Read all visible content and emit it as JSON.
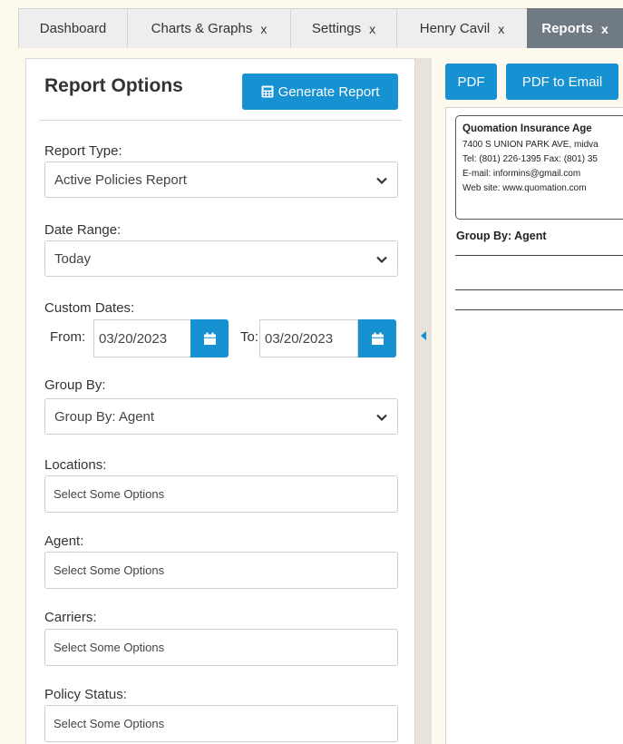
{
  "tabs": [
    {
      "label": "Dashboard",
      "closable": false
    },
    {
      "label": "Charts & Graphs",
      "closable": true
    },
    {
      "label": "Settings",
      "closable": true
    },
    {
      "label": "Henry Cavil",
      "closable": true
    },
    {
      "label": "Reports",
      "closable": true,
      "active": true
    }
  ],
  "tab_close_glyph": "x",
  "report_options": {
    "title": "Report Options",
    "generate_button": "Generate Report",
    "report_type": {
      "label": "Report Type:",
      "value": "Active Policies Report"
    },
    "date_range": {
      "label": "Date Range:",
      "value": "Today"
    },
    "custom_dates": {
      "label": "Custom Dates:",
      "from_label": "From:",
      "from_value": "03/20/2023",
      "to_label": "To:",
      "to_value": "03/20/2023"
    },
    "group_by": {
      "label": "Group By:",
      "value": "Group By: Agent"
    },
    "locations": {
      "label": "Locations:",
      "placeholder": "Select Some Options"
    },
    "agent": {
      "label": "Agent:",
      "placeholder": "Select Some Options"
    },
    "carriers": {
      "label": "Carriers:",
      "placeholder": "Select Some Options"
    },
    "policy_status": {
      "label": "Policy Status:",
      "placeholder": "Select Some Options"
    }
  },
  "preview": {
    "pdf_button": "PDF",
    "pdf_email_button": "PDF to Email",
    "company_name": "Quomation Insurance Age",
    "address": "7400 S UNION PARK AVE, midva",
    "phone": "Tel: (801) 226-1395 Fax: (801) 35",
    "email": "E-mail: informins@gmail.com",
    "website": "Web site: www.quomation.com",
    "group_by": "Group By: Agent"
  },
  "colors": {
    "accent": "#1691d2",
    "active_tab": "#707a83",
    "background": "#fdf9ec"
  }
}
